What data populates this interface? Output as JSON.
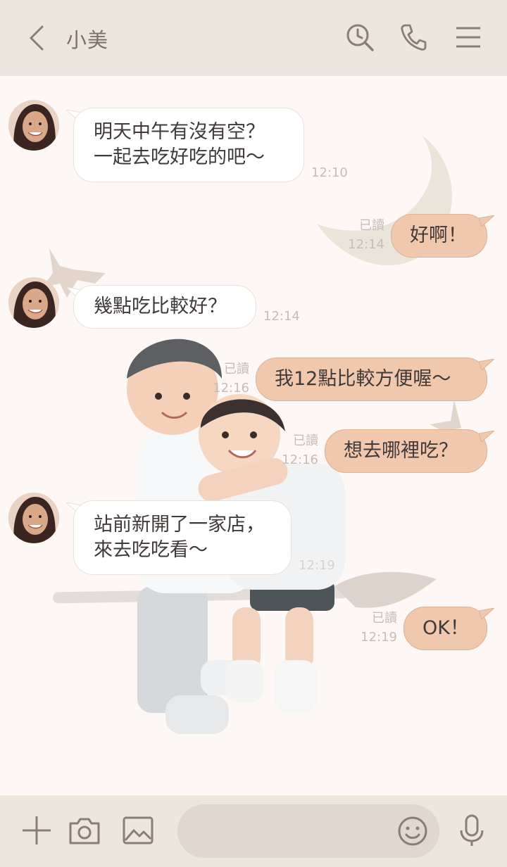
{
  "header": {
    "title": "小美"
  },
  "messages": [
    {
      "side": "in",
      "text": "明天中午有沒有空？\n一起去吃好吃的吧～",
      "time": "12:10"
    },
    {
      "side": "out",
      "text": "好啊！",
      "read": "已讀",
      "time": "12:14"
    },
    {
      "side": "in",
      "text": "幾點吃比較好？",
      "time": "12:14"
    },
    {
      "side": "out",
      "text": "我12點比較方便喔～",
      "read": "已讀",
      "time": "12:16"
    },
    {
      "side": "out",
      "text": "想去哪裡吃？",
      "read": "已讀",
      "time": "12:16"
    },
    {
      "side": "in",
      "text": "站前新開了一家店，\n來去吃吃看～",
      "time": "12:19"
    },
    {
      "side": "out",
      "text": "OK！",
      "read": "已讀",
      "time": "12:19"
    }
  ],
  "composer": {
    "placeholder": ""
  },
  "icons": {
    "back": "chevron-left-icon",
    "search": "search-clock-icon",
    "call": "phone-icon",
    "menu": "hamburger-menu-icon",
    "add": "plus-icon",
    "camera": "camera-icon",
    "gallery": "image-icon",
    "emoji": "smiley-icon",
    "voice": "microphone-icon"
  },
  "colors": {
    "header_bg": "#ede6df",
    "chat_bg": "#fdf8f5",
    "outgoing_bubble": "#f0c8ae",
    "incoming_bubble": "#ffffff",
    "icon": "#8a7d78"
  }
}
